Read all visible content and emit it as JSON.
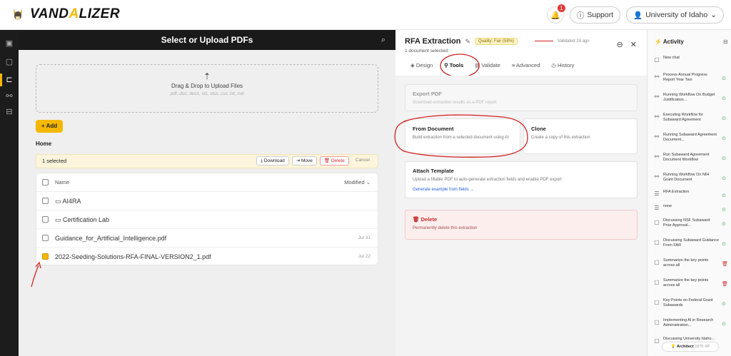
{
  "header": {
    "brand_pre": "VAND",
    "brand_a": "A",
    "brand_post": "LIZER",
    "notif_count": "1",
    "support_label": "Support",
    "org_label": "University of Idaho"
  },
  "files": {
    "title": "Select or Upload PDFs",
    "drop_title": "Drag & Drop to Upload Files",
    "drop_types": "pdf, doc, docx, xls, xlsx, csv, txt, md",
    "add_label": "+ Add",
    "folder": "Home",
    "selected_text": "1 selected",
    "actions": {
      "download": "Download",
      "move": "Move",
      "delete": "Delete",
      "cancel": "Cancel"
    },
    "col_name": "Name",
    "col_modified": "Modified",
    "rows": [
      {
        "name": "AI4RA",
        "type": "folder",
        "modified": "",
        "checked": false
      },
      {
        "name": "Certification Lab",
        "type": "folder",
        "modified": "",
        "checked": false
      },
      {
        "name": "Guidance_for_Artificial_Intelligence.pdf",
        "type": "file",
        "modified": "Jul 31",
        "checked": false
      },
      {
        "name": "2022-Seeding-Solutions-RFA-FINAL-VERSION2_1.pdf",
        "type": "file",
        "modified": "Jul 22",
        "checked": true
      }
    ]
  },
  "editor": {
    "title": "RFA Extraction",
    "quality": "Quality: Fair (58%)",
    "validated": "Validated 2d ago",
    "subtitle": "1 document selected",
    "tabs": [
      "Design",
      "Tools",
      "Validate",
      "Advanced",
      "History"
    ],
    "active_tab": "Tools",
    "export": {
      "title": "Export PDF",
      "desc": "Download extraction results as a PDF report"
    },
    "from_doc": {
      "title": "From Document",
      "desc": "Build extraction from a selected document using AI"
    },
    "clone": {
      "title": "Clone",
      "desc": "Create a copy of this extraction"
    },
    "attach": {
      "title": "Attach Template",
      "desc": "Upload a fillable PDF to auto-generate extraction fields and enable PDF export",
      "link": "Generate example from fields →"
    },
    "delete": {
      "title": "Delete",
      "desc": "Permanently delete this extraction"
    }
  },
  "activity": {
    "title": "Activity",
    "items": [
      {
        "icon": "chat",
        "text": "New chat",
        "status": ""
      },
      {
        "icon": "workflow",
        "text": "Process Annual Progress Report Year Two",
        "status": "ok"
      },
      {
        "icon": "workflow",
        "text": "Running Workflow On Budget Justification...",
        "status": "ok"
      },
      {
        "icon": "workflow",
        "text": "Executing Workflow for Subaward Agreement",
        "status": "ok"
      },
      {
        "icon": "workflow",
        "text": "Running Subaward Agreement Document...",
        "status": "ok"
      },
      {
        "icon": "workflow",
        "text": "Run Subaward Agreement Document Workflow",
        "status": "ok"
      },
      {
        "icon": "workflow",
        "text": "Running Workflow On NIH Grant Document",
        "status": "ok"
      },
      {
        "icon": "extract",
        "text": "RFA Extraction",
        "status": "ok"
      },
      {
        "icon": "extract",
        "text": "none",
        "status": "ok"
      },
      {
        "icon": "chat",
        "text": "Discussing NSF Subaward Prior Approval...",
        "status": "ok"
      },
      {
        "icon": "chat",
        "text": "Discussing Subaward Guidance From FAR",
        "status": "ok"
      },
      {
        "icon": "chat",
        "text": "Summarize the key points across all",
        "status": "err"
      },
      {
        "icon": "chat",
        "text": "Summarize the key points across all",
        "status": "err"
      },
      {
        "icon": "chat",
        "text": "Key Points on Federal Grant Subawards",
        "status": "ok"
      },
      {
        "icon": "chat",
        "text": "Implementing AI in Research Administration...",
        "status": "ok"
      },
      {
        "icon": "chat",
        "text": "Discussing University Idaho...",
        "status": ""
      }
    ],
    "architect_label": "Architect",
    "architect_xp": "1875 XP"
  },
  "colors": {
    "accent": "#f5b800",
    "annotation": "#d32020",
    "dark": "#1a1a1a"
  }
}
